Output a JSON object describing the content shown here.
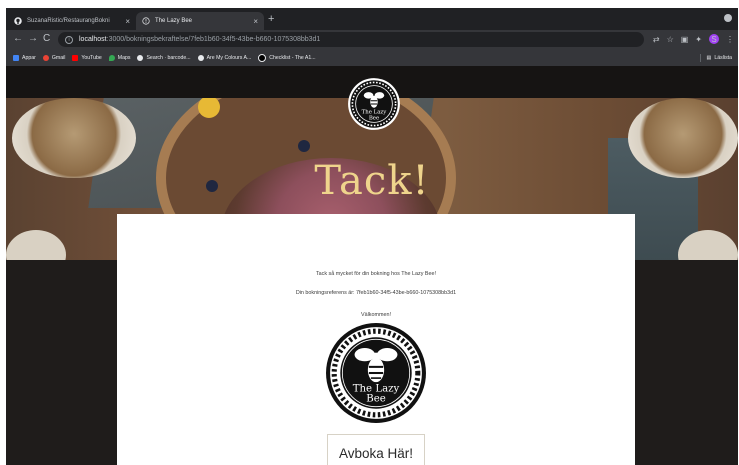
{
  "browser": {
    "tabs": [
      {
        "title": "SuzanaRistic/RestaurangBokni",
        "icon": "github-icon"
      },
      {
        "title": "The Lazy Bee",
        "icon": "globe-icon",
        "active": true
      }
    ],
    "address": {
      "host": "localhost",
      "path": ":3000/bokningsbekraftelse/7feb1b60-34f5-43be-b660-1075308bb3d1"
    },
    "profile_initial": "S"
  },
  "bookmarks": {
    "items": [
      {
        "label": "Appar",
        "color": "#4285f4"
      },
      {
        "label": "Gmail",
        "color": "#ea4335"
      },
      {
        "label": "YouTube",
        "color": "#ff0000"
      },
      {
        "label": "Maps",
        "color": "#34a853"
      },
      {
        "label": "Search · barcode...",
        "color": "#e8eaed"
      },
      {
        "label": "Are My Colours A...",
        "color": "#e8eaed"
      },
      {
        "label": "Checklist - The A1...",
        "color": "#202124"
      }
    ],
    "reading_list": "Läslista"
  },
  "page": {
    "hero_title": "Tack!",
    "logo_text": [
      "The Lazy",
      "Bee"
    ],
    "thanks_line": "Tack så mycket för din bokning hos The Lazy Bee!",
    "reference_line": "Din bokningsreferens är: 7feb1b60-34f5-43be-b660-1075308bb3d1",
    "welcome_line": "Välkommen!",
    "cancel_button": "Avboka Här!"
  },
  "colors": {
    "hero_text": "#efd48c",
    "page_bg": "#1f1c1b",
    "card_bg": "#ffffff"
  }
}
